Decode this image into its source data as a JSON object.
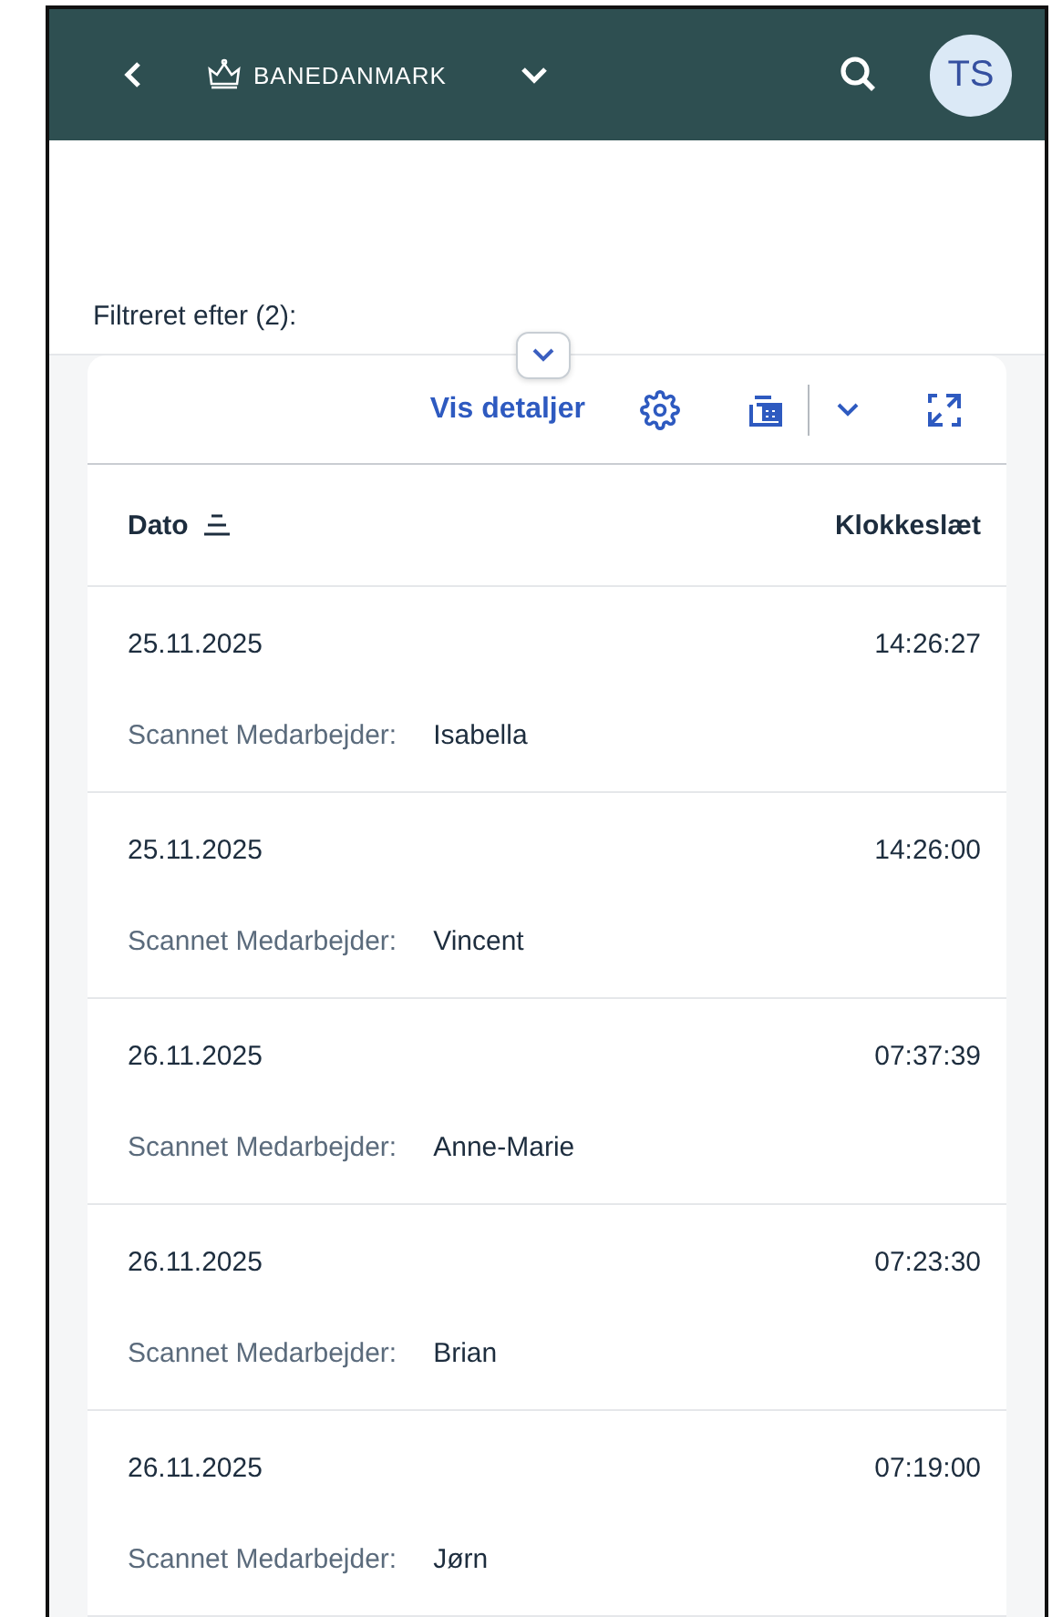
{
  "header": {
    "logo_text": "BANEDANMARK",
    "avatar": "TS"
  },
  "filter": {
    "label": "Filtreret efter (2):"
  },
  "toolbar": {
    "details_link": "Vis detaljer"
  },
  "table": {
    "columns": [
      "Dato",
      "Klokkeslæt"
    ],
    "rows": [
      {
        "date": "25.11.2025",
        "time": "14:26:27",
        "label": "Scannet Medarbejder:",
        "name": "Isabella"
      },
      {
        "date": "25.11.2025",
        "time": "14:26:00",
        "label": "Scannet Medarbejder:",
        "name": "Vincent"
      },
      {
        "date": "26.11.2025",
        "time": "07:37:39",
        "label": "Scannet Medarbejder:",
        "name": "Anne-Marie"
      },
      {
        "date": "26.11.2025",
        "time": "07:23:30",
        "label": "Scannet Medarbejder:",
        "name": "Brian"
      },
      {
        "date": "26.11.2025",
        "time": "07:19:00",
        "label": "Scannet Medarbejder:",
        "name": "Jørn"
      }
    ]
  }
}
